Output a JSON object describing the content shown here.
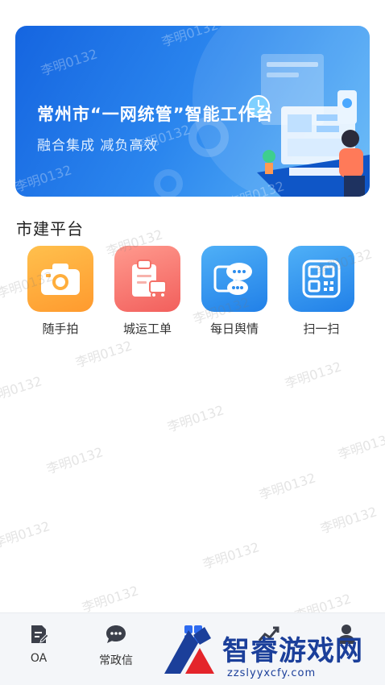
{
  "banner": {
    "title": "常州市“一网统管”智能工作台",
    "subtitle": "融合集成  减负高效"
  },
  "section": {
    "title": "市建平台"
  },
  "apps": [
    {
      "label": "随手拍",
      "icon": "camera-icon",
      "color": "#ffa93a"
    },
    {
      "label": "城运工单",
      "icon": "work-order-clipboard-icon",
      "color": "#f7716b"
    },
    {
      "label": "每日舆情",
      "icon": "public-opinion-chat-icon",
      "color": "#3296ee"
    },
    {
      "label": "扫一扫",
      "icon": "qr-scan-icon",
      "color": "#3296ee"
    }
  ],
  "watermark": {
    "text": "李明0132"
  },
  "tabbar": {
    "items": [
      {
        "label": "OA",
        "icon": "document-edit-icon"
      },
      {
        "label": "常政信",
        "icon": "chat-bubble-icon"
      },
      {
        "label": "",
        "icon": "apps-grid-icon"
      },
      {
        "label": "",
        "icon": "trend-chart-icon"
      },
      {
        "label": "",
        "icon": "person-icon"
      }
    ]
  },
  "logo_overlay": {
    "brand": "智睿游戏网",
    "domain": "zzslyyxcfy.com"
  },
  "colors": {
    "banner_blue": "#1a72e8",
    "tab_active": "#2e6bf0"
  }
}
